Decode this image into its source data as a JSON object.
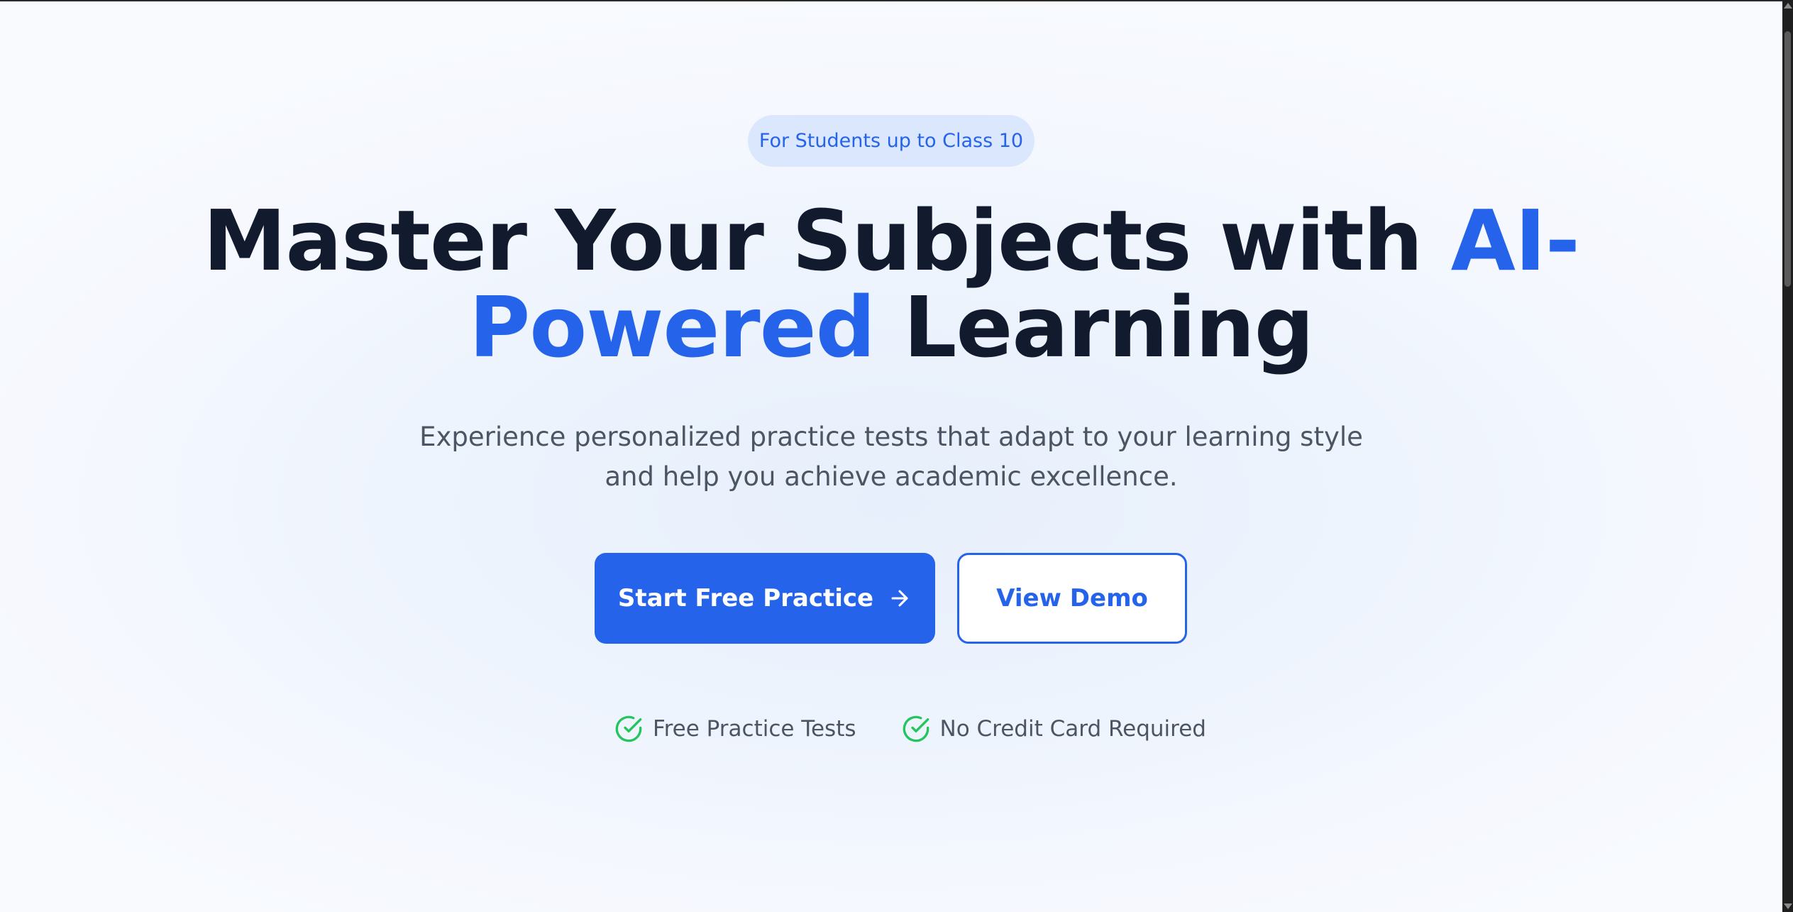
{
  "hero": {
    "badge": "For Students up to Class 10",
    "headline_part1": "Master Your Subjects with ",
    "headline_accent1": "AI-",
    "headline_accent2": "Powered",
    "headline_part2": " Learning",
    "subtitle_line1": "Experience personalized practice tests that adapt to your learning style",
    "subtitle_line2": "and help you achieve academic excellence.",
    "primary_button": "Start Free Practice",
    "secondary_button": "View Demo",
    "features": [
      {
        "label": "Free Practice Tests",
        "icon": "check-circle-icon"
      },
      {
        "label": "No Credit Card Required",
        "icon": "check-circle-icon"
      }
    ]
  },
  "colors": {
    "accent": "#2563eb",
    "heading": "#121b2e",
    "body_text": "#4b5563",
    "badge_bg": "#dae7fd",
    "success": "#22c55e"
  }
}
